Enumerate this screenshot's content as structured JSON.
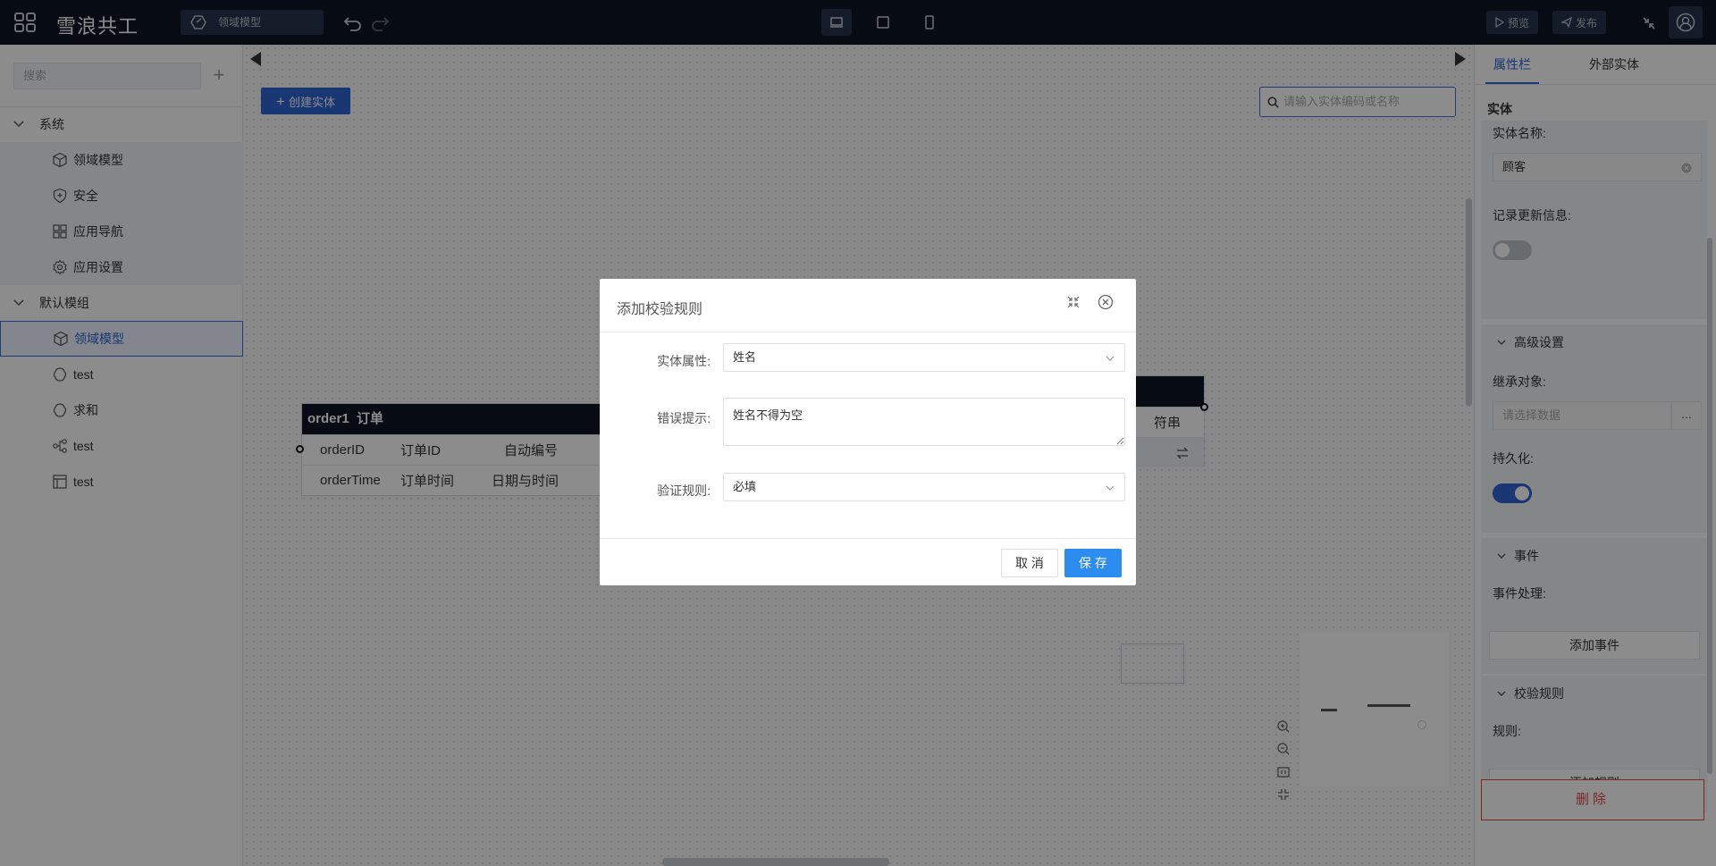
{
  "topbar": {
    "title": "雪浪共工",
    "breadcrumb": "领域模型",
    "preview_label": "预览",
    "publish_label": "发布"
  },
  "sidebar": {
    "search_placeholder": "搜索",
    "groups": [
      {
        "label": "系统",
        "items": [
          {
            "label": "领域模型",
            "icon": "cube-icon"
          },
          {
            "label": "安全",
            "icon": "shield-icon"
          },
          {
            "label": "应用导航",
            "icon": "grid-icon"
          },
          {
            "label": "应用设置",
            "icon": "gear-icon"
          }
        ]
      },
      {
        "label": "默认模组",
        "items": [
          {
            "label": "领域模型",
            "icon": "cube-icon",
            "selected": true
          },
          {
            "label": "test",
            "icon": "flow-icon"
          },
          {
            "label": "求和",
            "icon": "flow-icon"
          },
          {
            "label": "test",
            "icon": "branch-icon"
          },
          {
            "label": "test",
            "icon": "table-icon"
          }
        ]
      }
    ]
  },
  "canvas": {
    "create_label": "创建实体",
    "search_placeholder": "请输入实体编码或名称",
    "entity_order": {
      "code": "order1",
      "name": "订单",
      "rows": [
        {
          "code": "orderID",
          "name": "订单ID",
          "type": "自动编号"
        },
        {
          "code": "orderTime",
          "name": "订单时间",
          "type": "日期与时间"
        }
      ]
    },
    "entity_right": {
      "row_type": "符串"
    }
  },
  "right_panel": {
    "tabs": [
      "属性栏",
      "外部实体"
    ],
    "section_title": "实体",
    "entity_name_label": "实体名称:",
    "entity_name_value": "顾客",
    "record_update_label": "记录更新信息:",
    "advanced_title": "高级设置",
    "inherit_label": "继承对象:",
    "inherit_placeholder": "请选择数据",
    "inherit_more": "...",
    "persist_label": "持久化:",
    "events_title": "事件",
    "event_handler_label": "事件处理:",
    "add_event_label": "添加事件",
    "validation_title": "校验规则",
    "rules_label": "规则:",
    "add_rule_label": "添加规则",
    "delete_label": "删除"
  },
  "modal": {
    "title": "添加校验规则",
    "attr_label": "实体属性:",
    "attr_value": "姓名",
    "error_label": "错误提示:",
    "error_value": "姓名不得为空",
    "rule_label": "验证规则:",
    "rule_value": "必填",
    "cancel_label": "取 消",
    "save_label": "保 存"
  },
  "colors": {
    "topbar": "#0b1526",
    "accent": "#2d64d2",
    "save": "#2d8cf0",
    "danger": "#e64545"
  }
}
